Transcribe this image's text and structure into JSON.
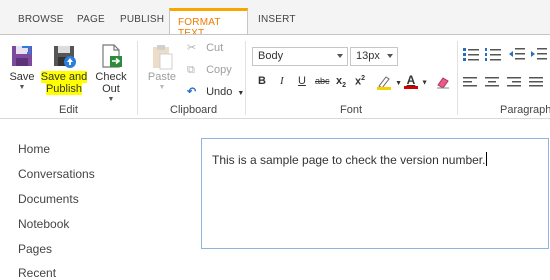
{
  "tabs": [
    {
      "label": "BROWSE"
    },
    {
      "label": "PAGE"
    },
    {
      "label": "PUBLISH"
    },
    {
      "label": "FORMAT TEXT"
    },
    {
      "label": "INSERT"
    }
  ],
  "ribbon": {
    "edit_group": {
      "label": "Edit",
      "save": "Save",
      "save_publish_line1": "Save and",
      "save_publish_line2": "Publish",
      "checkout": "Check Out"
    },
    "clipboard_group": {
      "label": "Clipboard",
      "paste": "Paste",
      "cut": "Cut",
      "copy": "Copy",
      "undo": "Undo"
    },
    "font_group": {
      "label": "Font",
      "style_value": "Body",
      "size_value": "13px",
      "bold": "B",
      "italic": "I",
      "underline": "U",
      "strikethrough": "abc",
      "subscript": "x",
      "superscript": "x",
      "highlight_color": "#f7d000",
      "font_color": "#d20000"
    },
    "paragraph_group": {
      "label": "Paragraph"
    }
  },
  "nav": {
    "items": [
      "Home",
      "Conversations",
      "Documents",
      "Notebook",
      "Pages",
      "Recent"
    ]
  },
  "editor": {
    "content": "This is a sample page to check the version number."
  }
}
